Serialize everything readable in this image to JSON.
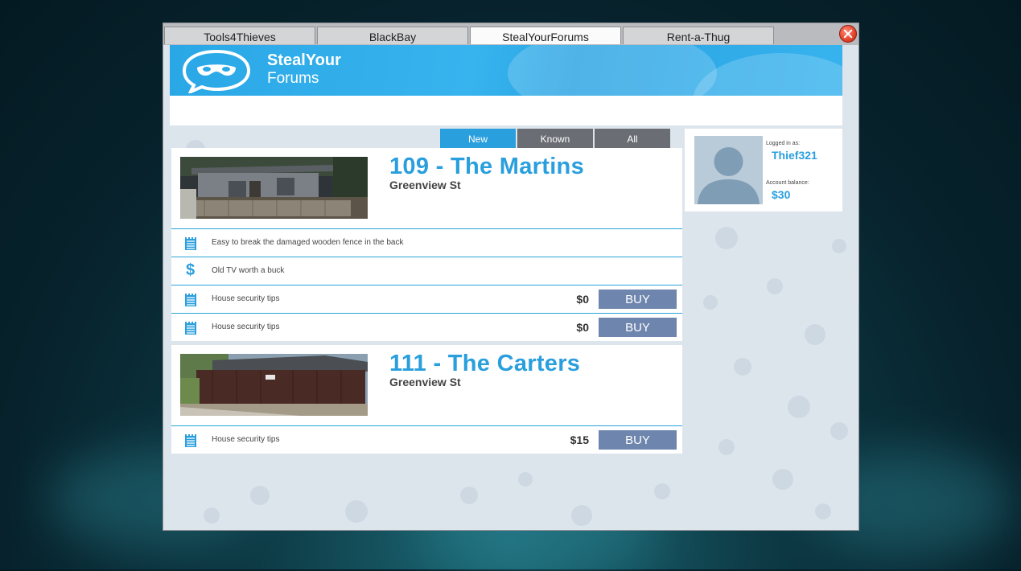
{
  "window": {
    "tabs": [
      {
        "label": "Tools4Thieves",
        "active": false
      },
      {
        "label": "BlackBay",
        "active": false
      },
      {
        "label": "StealYourForums",
        "active": true
      },
      {
        "label": "Rent-a-Thug",
        "active": false
      }
    ],
    "close_icon": "close-icon"
  },
  "banner": {
    "brand_line1": "StealYour",
    "brand_line2": "Forums",
    "logo_icon": "masked-speech-bubble-icon"
  },
  "filter_tabs": [
    {
      "label": "New",
      "active": true
    },
    {
      "label": "Known",
      "active": false
    },
    {
      "label": "All",
      "active": false
    }
  ],
  "houses": [
    {
      "title": "109 - The Martins",
      "street": "Greenview St",
      "tips": [
        {
          "icon": "notepad-icon",
          "text": "Easy to break the damaged wooden fence in the back",
          "price": "",
          "buy": ""
        },
        {
          "icon": "dollar-icon",
          "text": "Old TV worth a buck",
          "price": "",
          "buy": ""
        },
        {
          "icon": "notepad-icon",
          "text": "House security tips",
          "price": "$0",
          "buy": "BUY"
        },
        {
          "icon": "notepad-icon",
          "text": "House security tips",
          "price": "$0",
          "buy": "BUY"
        }
      ]
    },
    {
      "title": "111 - The Carters",
      "street": "Greenview St",
      "tips": [
        {
          "icon": "notepad-icon",
          "text": "House security tips",
          "price": "$15",
          "buy": "BUY"
        }
      ]
    }
  ],
  "profile": {
    "logged_in_label": "Logged in as:",
    "username": "Thief321",
    "balance_label": "Account balance:",
    "balance": "$30"
  },
  "colors": {
    "accent": "#2a9fdd",
    "buy_button": "#6e86ad",
    "close_button": "#e8472f"
  }
}
